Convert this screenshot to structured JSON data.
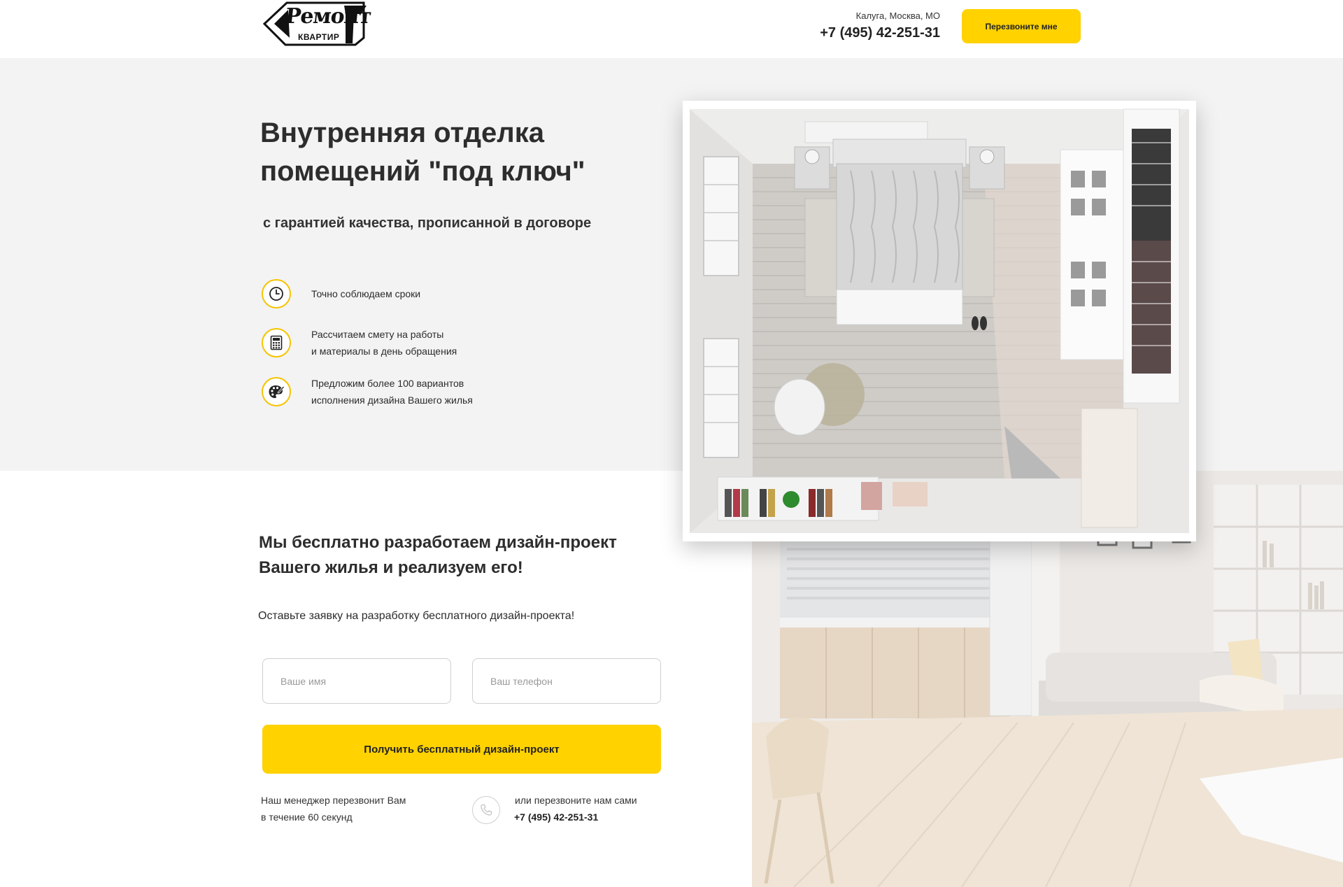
{
  "header": {
    "logo_word": "Ремонт",
    "logo_sub": "КВАРТИР",
    "city": "Калуга, Москва, МО",
    "phone": "+7 (495) 42-251-31",
    "callback_label": "Перезвоните мне"
  },
  "hero": {
    "title": "Внутренняя отделка помещений \"под ключ\"",
    "subtitle": "с гарантией качества, прописанной в договоре",
    "features": [
      {
        "icon": "clock-icon",
        "text": "Точно соблюдаем сроки"
      },
      {
        "icon": "calculator-icon",
        "text": "Рассчитаем смету на работы\nи материалы в день обращения"
      },
      {
        "icon": "palette-icon",
        "text": "Предложим более 100 вариантов\nисполнения дизайна Вашего жилья"
      }
    ]
  },
  "form": {
    "title": "Мы бесплатно разработаем дизайн-проект Вашего жилья и реализуем его!",
    "subtitle": "Оставьте заявку на разработку бесплатного дизайн-проекта!",
    "name_placeholder": "Ваше имя",
    "phone_placeholder": "Ваш телефон",
    "submit_label": "Получить бесплатный дизайн-проект",
    "note": "Наш менеджер перезвонит Вам\nв течение 60 секунд",
    "call_text": "или перезвоните нам сами",
    "call_phone": "+7 (495) 42-251-31"
  },
  "colors": {
    "accent": "#ffd200",
    "hero_bg": "#f3f3f3",
    "text": "#2d2d2d"
  }
}
